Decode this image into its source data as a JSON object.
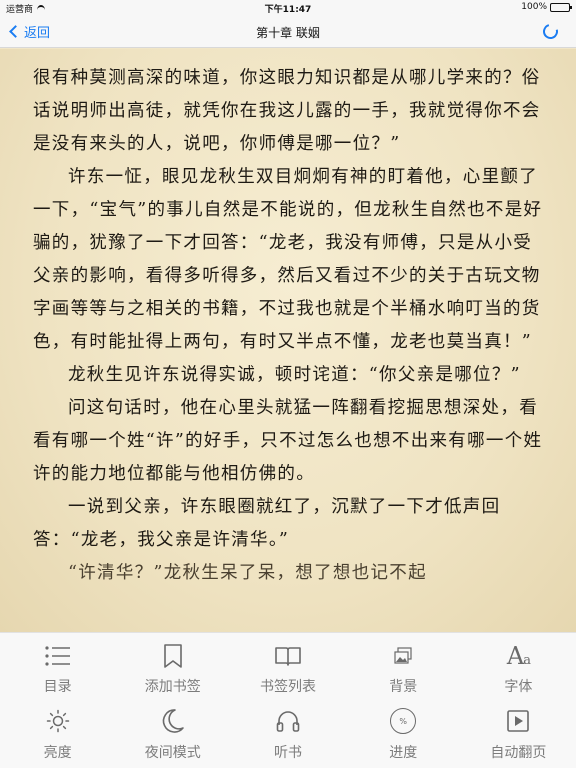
{
  "status_bar": {
    "carrier": "运营商",
    "time": "下午11:47",
    "battery": "100%",
    "battery_level": 1.0
  },
  "nav": {
    "back_label": "返回",
    "title": "第十章 联姻"
  },
  "content": {
    "paragraphs": [
      {
        "style": "cont",
        "text": "很有种莫测高深的味道，你这眼力知识都是从哪儿学来的？俗话说明师出高徒，就凭你在我这儿露的一手，我就觉得你不会是没有来头的人，说吧，你师傅是哪一位？”"
      },
      {
        "style": "indent",
        "text": "许东一怔，眼见龙秋生双目炯炯有神的盯着他，心里颤了一下，“宝气”的事儿自然是不能说的，但龙秋生自然也不是好骗的，犹豫了一下才回答：“龙老，我没有师傅，只是从小受父亲的影响，看得多听得多，然后又看过不少的关于古玩文物字画等等与之相关的书籍，不过我也就是个半桶水响叮当的货色，有时能扯得上两句，有时又半点不懂，龙老也莫当真！”"
      },
      {
        "style": "indent",
        "text": "龙秋生见许东说得实诚，顿时诧道：“你父亲是哪位？”"
      },
      {
        "style": "indent",
        "text": "问这句话时，他在心里头就猛一阵翻看挖掘思想深处，看看有哪一个姓“许”的好手，只不过怎么也想不出来有哪一个姓许的能力地位都能与他相仿佛的。"
      },
      {
        "style": "indent",
        "text": "一说到父亲，许东眼圈就红了，沉默了一下才低声回答：“龙老，我父亲是许清华。”"
      },
      {
        "style": "clip",
        "text": "“许清华？”龙秋生呆了呆，想了想也记不起"
      }
    ]
  },
  "toolbar": {
    "row1": [
      {
        "label": "目录",
        "icon": "list-icon"
      },
      {
        "label": "添加书签",
        "icon": "bookmark-icon"
      },
      {
        "label": "书签列表",
        "icon": "open-book-icon"
      },
      {
        "label": "背景",
        "icon": "image-icon"
      },
      {
        "label": "字体",
        "icon": "font-icon",
        "glyph": "Aa"
      }
    ],
    "row2": [
      {
        "label": "亮度",
        "icon": "sun-icon"
      },
      {
        "label": "夜间模式",
        "icon": "moon-icon"
      },
      {
        "label": "听书",
        "icon": "headphones-icon"
      },
      {
        "label": "进度",
        "icon": "progress-icon",
        "glyph": "%"
      },
      {
        "label": "自动翻页",
        "icon": "play-icon"
      }
    ]
  }
}
